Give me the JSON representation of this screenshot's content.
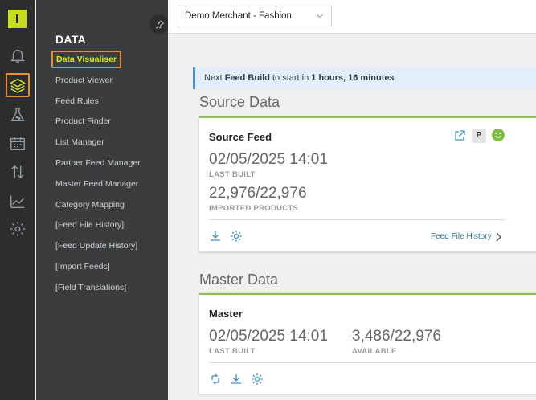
{
  "nav": {
    "title": "DATA",
    "items": [
      {
        "label": "Data Visualiser",
        "active": true
      },
      {
        "label": "Product Viewer"
      },
      {
        "label": "Feed Rules"
      },
      {
        "label": "Product Finder"
      },
      {
        "label": "List Manager"
      },
      {
        "label": "Partner Feed Manager"
      },
      {
        "label": "Master Feed Manager"
      },
      {
        "label": "Category Mapping"
      },
      {
        "label": "[Feed File History]"
      },
      {
        "label": "[Feed Update History]"
      },
      {
        "label": "[Import Feeds]"
      },
      {
        "label": "[Field Translations]"
      }
    ]
  },
  "rail": {
    "icons": [
      "logo",
      "bell-icon",
      "layers-icon",
      "flask-icon",
      "calendar-icon",
      "sort-arrows-icon",
      "chart-icon",
      "gear-icon"
    ],
    "active": "layers-icon"
  },
  "topbar": {
    "merchant": "Demo Merchant - Fashion"
  },
  "banner": {
    "prefix": "Next ",
    "feed": "Feed Build",
    "middle": " to start in ",
    "time": "1 hours, 16 minutes"
  },
  "source": {
    "section_title": "Source Data",
    "card_title": "Source Feed",
    "badge": "P",
    "last_built": "02/05/2025 14:01",
    "last_built_label": "LAST BUILT",
    "imported": "22,976/22,976",
    "imported_label": "IMPORTED PRODUCTS",
    "link": "Feed File History"
  },
  "master": {
    "section_title": "Master Data",
    "card_title": "Master",
    "last_built": "02/05/2025 14:01",
    "last_built_label": "LAST BUILT",
    "available": "3,486/22,976",
    "available_label": "AVAILABLE"
  },
  "colors": {
    "accent_green": "#8cc14e",
    "brand_lime": "#c8de1a",
    "highlight_orange": "#f28a30",
    "banner_blue": "#3f8fd2"
  }
}
